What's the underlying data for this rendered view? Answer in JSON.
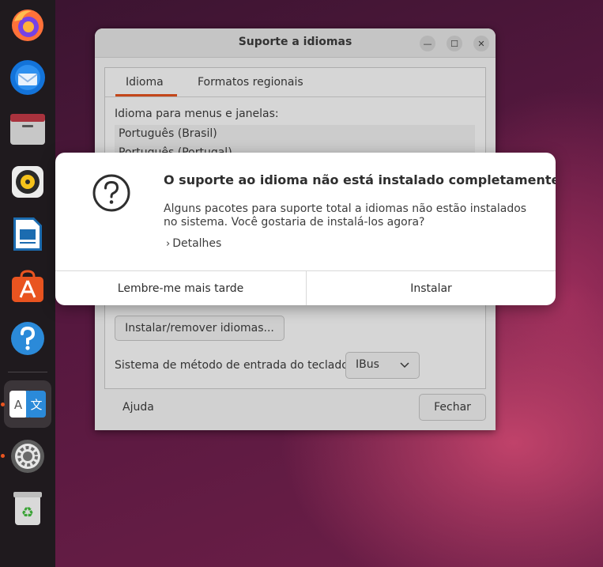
{
  "dock": {
    "items": [
      {
        "name": "firefox-icon"
      },
      {
        "name": "thunderbird-icon"
      },
      {
        "name": "files-icon"
      },
      {
        "name": "rhythmbox-icon"
      },
      {
        "name": "libreoffice-writer-icon"
      },
      {
        "name": "app-center-icon"
      },
      {
        "name": "help-icon"
      },
      {
        "name": "language-support-icon",
        "glyph_a": "A",
        "glyph_b": "文"
      },
      {
        "name": "settings-icon"
      },
      {
        "name": "trash-icon"
      }
    ],
    "running_color": "#e95420"
  },
  "window": {
    "title": "Suporte a idiomas",
    "tabs": [
      "Idioma",
      "Formatos regionais"
    ],
    "active_tab": "Idioma",
    "language_label": "Idioma para menus e janelas:",
    "languages": [
      "Português (Brasil)",
      "Português (Portugal)"
    ],
    "install_button": "Instalar/remover idiomas...",
    "keyboard_label": "Sistema de método de entrada do teclado:",
    "keyboard_value": "IBus",
    "help_button": "Ajuda",
    "close_button": "Fechar",
    "minimize_glyph": "—",
    "maximize_glyph": "☐",
    "close_glyph": "✕"
  },
  "dialog": {
    "title": "O suporte ao idioma não está instalado completamente",
    "body": "Alguns pacotes para suporte total a idiomas não estão instalados no sistema. Você gostaria de instalá-los agora?",
    "details_label": "Detalhes",
    "remind_later": "Lembre-me mais tarde",
    "install": "Instalar"
  },
  "colors": {
    "accent": "#e95420"
  }
}
